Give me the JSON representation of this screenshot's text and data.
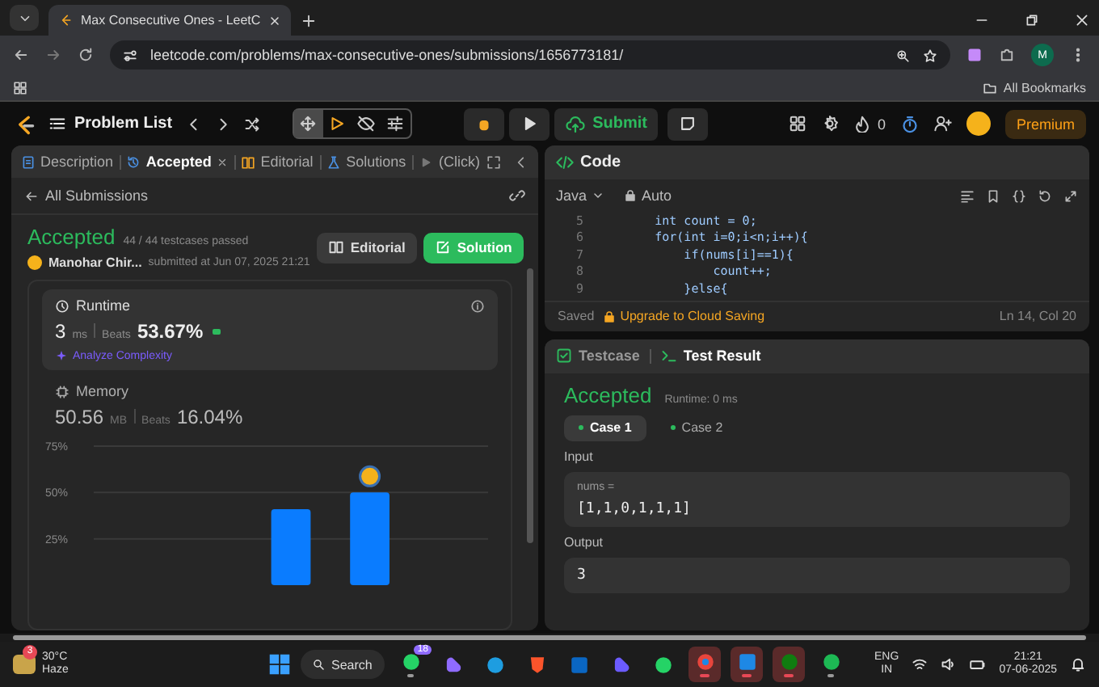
{
  "browser": {
    "tab_title": "Max Consecutive Ones - LeetC",
    "url": "leetcode.com/problems/max-consecutive-ones/submissions/1656773181/",
    "profile_initial": "M",
    "bookmarks_label": "All Bookmarks"
  },
  "nav": {
    "problem_list": "Problem List",
    "tools": [
      {
        "kind": "move",
        "selected": true
      },
      {
        "kind": "play",
        "selected": false
      },
      {
        "kind": "hide",
        "selected": false
      },
      {
        "kind": "sliders",
        "selected": false
      }
    ],
    "submit": "Submit",
    "streak": "0",
    "premium": "Premium"
  },
  "left_panel": {
    "tabs": [
      {
        "kind": "description",
        "label": "Description",
        "selected": false
      },
      {
        "kind": "submission",
        "label": "Accepted",
        "selected": true
      },
      {
        "kind": "editorial",
        "label": "Editorial",
        "selected": false
      },
      {
        "kind": "solutions",
        "label": "Solutions",
        "selected": false
      },
      {
        "kind": "click",
        "label": "(Click)",
        "selected": false
      }
    ],
    "back_link": "All Submissions",
    "result": {
      "status": "Accepted",
      "passed": "44 / 44 testcases passed",
      "user": "Manohar Chir...",
      "submitted": "submitted at Jun 07, 2025 21:21",
      "buttons": [
        {
          "kind": "editorial",
          "label": "Editorial"
        },
        {
          "kind": "solution",
          "label": "Solution"
        }
      ]
    },
    "metrics": [
      {
        "kind": "runtime",
        "title": "Runtime",
        "value": "3",
        "unit": "ms",
        "beats_label": "Beats",
        "beats": "53.67%",
        "selected": true,
        "analyze": "Analyze Complexity"
      },
      {
        "kind": "memory",
        "title": "Memory",
        "value": "50.56",
        "unit": "MB",
        "beats_label": "Beats",
        "beats": "16.04%",
        "selected": false
      }
    ],
    "chart_data": {
      "type": "bar",
      "series": [
        {
          "color": "#0a7cff",
          "values": [
            null,
            null,
            41,
            50,
            null
          ]
        }
      ],
      "ylim": [
        0,
        75
      ],
      "yticks": [
        {
          "value": 25,
          "label": "25%"
        },
        {
          "value": 50,
          "label": "50%"
        },
        {
          "value": 75,
          "label": "75%"
        }
      ],
      "grid": true
    }
  },
  "code_panel": {
    "title": "Code",
    "language": "Java",
    "mode": "Auto",
    "lines": [
      {
        "number": "5",
        "text": "        int count = 0;"
      },
      {
        "number": "6",
        "text": "        for(int i=0;i<n;i++){"
      },
      {
        "number": "7",
        "text": "            if(nums[i]==1){"
      },
      {
        "number": "8",
        "text": "                count++;"
      },
      {
        "number": "9",
        "text": "            }else{"
      }
    ],
    "saved": "Saved",
    "upgrade": "Upgrade to Cloud Saving",
    "cursor": "Ln 14, Col 20"
  },
  "result_panel": {
    "tabs": [
      {
        "label": "Testcase",
        "selected": false
      },
      {
        "label": "Test Result",
        "selected": true
      }
    ],
    "status": "Accepted",
    "runtime": "Runtime: 0 ms",
    "cases": [
      {
        "label": "Case 1",
        "selected": true
      },
      {
        "label": "Case 2",
        "selected": false
      }
    ],
    "input_label": "Input",
    "inputs": [
      {
        "name": "nums =",
        "value": "[1,1,0,1,1,1]"
      }
    ],
    "output_label": "Output",
    "output": "3"
  },
  "taskbar": {
    "weather": {
      "badge": "3",
      "temperature": "30°C",
      "condition": "Haze"
    },
    "search": "Search",
    "apps": [
      {
        "kind": "phone",
        "badge": "18",
        "running": true,
        "active": false
      },
      {
        "kind": "assistant",
        "running": false,
        "active": false
      },
      {
        "kind": "edge",
        "running": false,
        "active": false
      },
      {
        "kind": "lion",
        "running": false,
        "active": false
      },
      {
        "kind": "network",
        "running": false,
        "active": false
      },
      {
        "kind": "assistant2",
        "running": false,
        "active": false
      },
      {
        "kind": "chat",
        "running": false,
        "active": false
      },
      {
        "kind": "chrome",
        "running": true,
        "active": true
      },
      {
        "kind": "notes",
        "running": true,
        "active": true
      },
      {
        "kind": "game",
        "running": true,
        "active": true
      },
      {
        "kind": "music",
        "running": true,
        "active": false
      }
    ],
    "language": "ENG",
    "region": "IN",
    "time": "21:21",
    "date": "07-06-2025"
  }
}
